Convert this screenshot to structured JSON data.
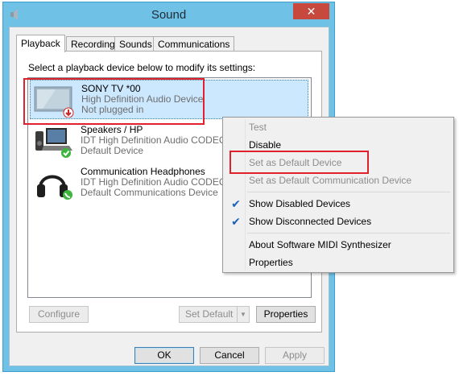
{
  "window": {
    "title": "Sound",
    "close_glyph": "✕"
  },
  "tabs": [
    {
      "label": "Playback",
      "active": true
    },
    {
      "label": "Recording",
      "active": false
    },
    {
      "label": "Sounds",
      "active": false
    },
    {
      "label": "Communications",
      "active": false
    }
  ],
  "instruction": "Select a playback device below to modify its settings:",
  "devices": [
    {
      "name": "SONY TV  *00",
      "line1": "High Definition Audio Device",
      "line2": "Not plugged in",
      "icon": "tv-monitor-icon",
      "status_icon": "unplugged-icon",
      "selected": true
    },
    {
      "name": "Speakers / HP",
      "line1": "IDT High Definition Audio CODEC",
      "line2": "Default Device",
      "icon": "laptop-speakers-icon",
      "status_icon": "default-check-icon",
      "selected": false
    },
    {
      "name": "Communication Headphones",
      "line1": "IDT High Definition Audio CODEC",
      "line2": "Default Communications Device",
      "icon": "headphones-icon",
      "status_icon": "phone-icon",
      "selected": false
    }
  ],
  "buttons": {
    "configure": "Configure",
    "set_default": "Set Default",
    "properties": "Properties",
    "ok": "OK",
    "cancel": "Cancel",
    "apply": "Apply"
  },
  "context_menu": {
    "items": [
      {
        "label": "Test",
        "enabled": false,
        "checked": false
      },
      {
        "label": "Disable",
        "enabled": true,
        "checked": false
      },
      {
        "label": "Set as Default Device",
        "enabled": false,
        "checked": false
      },
      {
        "label": "Set as Default Communication Device",
        "enabled": false,
        "checked": false
      },
      {
        "label": "Show Disabled Devices",
        "enabled": true,
        "checked": true
      },
      {
        "label": "Show Disconnected Devices",
        "enabled": true,
        "checked": true
      },
      {
        "label": "About Software MIDI Synthesizer",
        "enabled": true,
        "checked": false
      },
      {
        "label": "Properties",
        "enabled": true,
        "checked": false
      }
    ],
    "check_glyph": "✔"
  },
  "colors": {
    "window_frame": "#6fc2e6",
    "close_button": "#c7483d",
    "selection": "#cce8ff",
    "highlight_box": "#e0212b",
    "check_mark": "#1a62b8",
    "default_badge": "#3cb53c"
  }
}
